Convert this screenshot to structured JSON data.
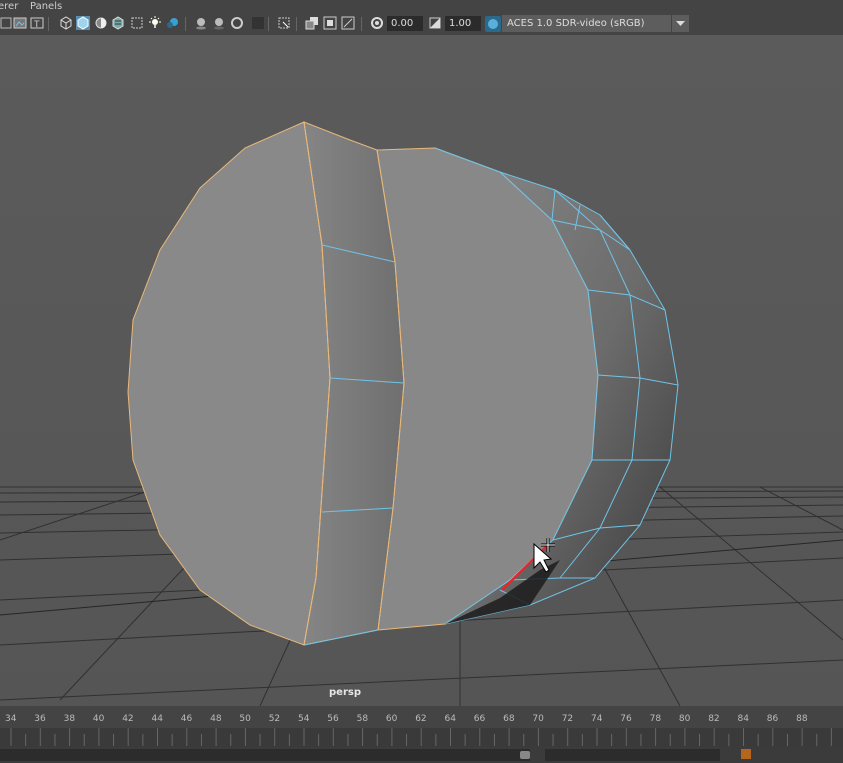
{
  "menu": {
    "items": [
      "erer",
      "Panels"
    ]
  },
  "toolbar": {
    "exposure_value": "0.00",
    "gamma_value": "1.00",
    "color_management": "ACES 1.0 SDR-video (sRGB)",
    "icons": [
      "camera-attributes-icon",
      "image-plane-icon",
      "2d-pan-zoom-icon",
      "wireframe-icon",
      "smooth-shade-icon",
      "use-default-material-icon",
      "textured-icon",
      "use-all-lights-icon",
      "shadows-icon",
      "screen-space-ao-icon",
      "motion-blur-icon",
      "anti-aliasing-icon",
      "isolate-select-icon",
      "xray-icon",
      "xray-joints-icon",
      "backface-culling-icon",
      "resolution-gate-icon",
      "exposure-icon",
      "gamma-icon",
      "color-management-icon"
    ]
  },
  "viewport": {
    "camera": "persp"
  },
  "timeline": {
    "ticks": [
      "34",
      "36",
      "38",
      "40",
      "42",
      "44",
      "46",
      "48",
      "50",
      "52",
      "54",
      "56",
      "58",
      "60",
      "62",
      "64",
      "66",
      "68",
      "70",
      "72",
      "74",
      "76",
      "78",
      "80",
      "82",
      "84",
      "86",
      "88"
    ]
  },
  "colors": {
    "selected_faces": "#6fc4e8",
    "selected_edges": "#e8b87a",
    "active_edge": "#e0292a",
    "grid": "#1e1e1e"
  }
}
